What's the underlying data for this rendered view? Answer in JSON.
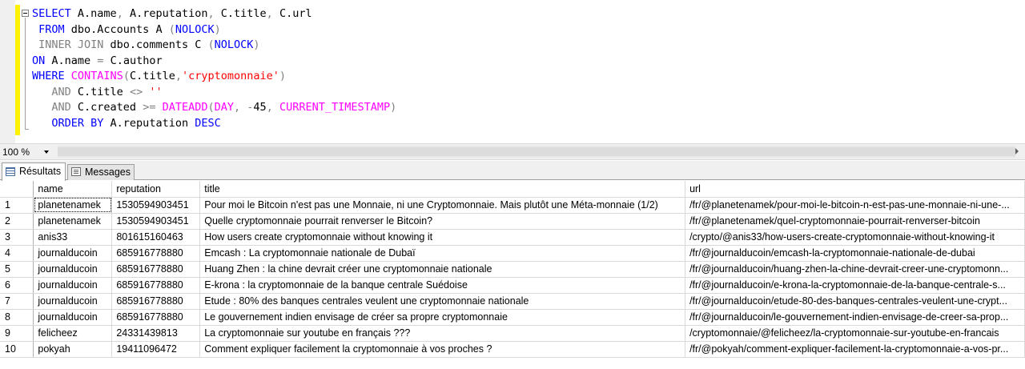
{
  "editor": {
    "lines": [
      [
        {
          "t": "SELECT ",
          "c": "kw"
        },
        {
          "t": "A.name",
          "c": ""
        },
        {
          "t": ", ",
          "c": "gr"
        },
        {
          "t": "A.reputation",
          "c": ""
        },
        {
          "t": ", ",
          "c": "gr"
        },
        {
          "t": "C.title",
          "c": ""
        },
        {
          "t": ", ",
          "c": "gr"
        },
        {
          "t": "C.url",
          "c": ""
        }
      ],
      [
        {
          "t": " FROM ",
          "c": "kw"
        },
        {
          "t": "dbo.Accounts A ",
          "c": ""
        },
        {
          "t": "(",
          "c": "gr"
        },
        {
          "t": "NOLOCK",
          "c": "kw"
        },
        {
          "t": ")",
          "c": "gr"
        }
      ],
      [
        {
          "t": " INNER JOIN ",
          "c": "gr"
        },
        {
          "t": "dbo.comments C ",
          "c": ""
        },
        {
          "t": "(",
          "c": "gr"
        },
        {
          "t": "NOLOCK",
          "c": "kw"
        },
        {
          "t": ")",
          "c": "gr"
        }
      ],
      [
        {
          "t": "ON ",
          "c": "kw"
        },
        {
          "t": "A.name ",
          "c": ""
        },
        {
          "t": "= ",
          "c": "gr"
        },
        {
          "t": "C.author",
          "c": ""
        }
      ],
      [
        {
          "t": "WHERE ",
          "c": "kw"
        },
        {
          "t": "CONTAINS",
          "c": "fn"
        },
        {
          "t": "(",
          "c": "gr"
        },
        {
          "t": "C.title",
          "c": ""
        },
        {
          "t": ",",
          "c": "gr"
        },
        {
          "t": "'cryptomonnaie'",
          "c": "st"
        },
        {
          "t": ")",
          "c": "gr"
        }
      ],
      [
        {
          "t": "   AND ",
          "c": "gr"
        },
        {
          "t": "C.title ",
          "c": ""
        },
        {
          "t": "<> ",
          "c": "gr"
        },
        {
          "t": "''",
          "c": "st"
        }
      ],
      [
        {
          "t": "   AND ",
          "c": "gr"
        },
        {
          "t": "C.created ",
          "c": ""
        },
        {
          "t": ">= ",
          "c": "gr"
        },
        {
          "t": "DATEADD",
          "c": "fn"
        },
        {
          "t": "(",
          "c": "gr"
        },
        {
          "t": "DAY",
          "c": "fn"
        },
        {
          "t": ", ",
          "c": "gr"
        },
        {
          "t": "-",
          "c": "gr"
        },
        {
          "t": "45",
          "c": ""
        },
        {
          "t": ", ",
          "c": "gr"
        },
        {
          "t": "CURRENT_TIMESTAMP",
          "c": "fn"
        },
        {
          "t": ")",
          "c": "gr"
        }
      ],
      [
        {
          "t": "   ORDER BY ",
          "c": "kw"
        },
        {
          "t": "A.reputation ",
          "c": ""
        },
        {
          "t": "DESC",
          "c": "kw"
        }
      ]
    ]
  },
  "zoom": {
    "value": "100 %"
  },
  "tabs": {
    "results_label": "Résultats",
    "messages_label": "Messages"
  },
  "results": {
    "columns": [
      "name",
      "reputation",
      "title",
      "url"
    ],
    "rows": [
      [
        "1",
        "planetenamek",
        "1530594903451",
        "Pour moi le Bitcoin n'est pas une Monnaie, ni une Cryptomonnaie. Mais plutôt une Méta-monnaie (1/2)",
        "/fr/@planetenamek/pour-moi-le-bitcoin-n-est-pas-une-monnaie-ni-une-..."
      ],
      [
        "2",
        "planetenamek",
        "1530594903451",
        "Quelle cryptomonnaie pourrait renverser le Bitcoin?",
        "/fr/@planetenamek/quel-cryptomonnaie-pourrait-renverser-bitcoin"
      ],
      [
        "3",
        "anis33",
        "801615160463",
        "How users create cryptomonnaie without knowing it",
        "/crypto/@anis33/how-users-create-cryptomonnaie-without-knowing-it"
      ],
      [
        "4",
        "journalducoin",
        "685916778880",
        "Emcash : La cryptomonnaie nationale de Dubaï",
        "/fr/@journalducoin/emcash-la-cryptomonnaie-nationale-de-dubai"
      ],
      [
        "5",
        "journalducoin",
        "685916778880",
        "Huang Zhen : la chine devrait créer une cryptomonnaie nationale",
        "/fr/@journalducoin/huang-zhen-la-chine-devrait-creer-une-cryptomonn..."
      ],
      [
        "6",
        "journalducoin",
        "685916778880",
        "E-krona : la cryptomonnaie de la banque centrale Suédoise",
        "/fr/@journalducoin/e-krona-la-cryptomonnaie-de-la-banque-centrale-s..."
      ],
      [
        "7",
        "journalducoin",
        "685916778880",
        "Etude : 80% des banques centrales veulent une cryptomonnaie nationale",
        "/fr/@journalducoin/etude-80-des-banques-centrales-veulent-une-crypt..."
      ],
      [
        "8",
        "journalducoin",
        "685916778880",
        "Le gouvernement indien envisage de créer sa propre cryptomonnaie",
        "/fr/@journalducoin/le-gouvernement-indien-envisage-de-creer-sa-prop..."
      ],
      [
        "9",
        "felicheez",
        "24331439813",
        "La cryptomonnaie sur youtube en français ???",
        "/cryptomonnaie/@felicheez/la-cryptomonnaie-sur-youtube-en-francais"
      ],
      [
        "10",
        "pokyah",
        "19411096472",
        "Comment expliquer facilement la cryptomonnaie à vos proches ?",
        "/fr/@pokyah/comment-expliquer-facilement-la-cryptomonnaie-a-vos-pr..."
      ]
    ]
  }
}
